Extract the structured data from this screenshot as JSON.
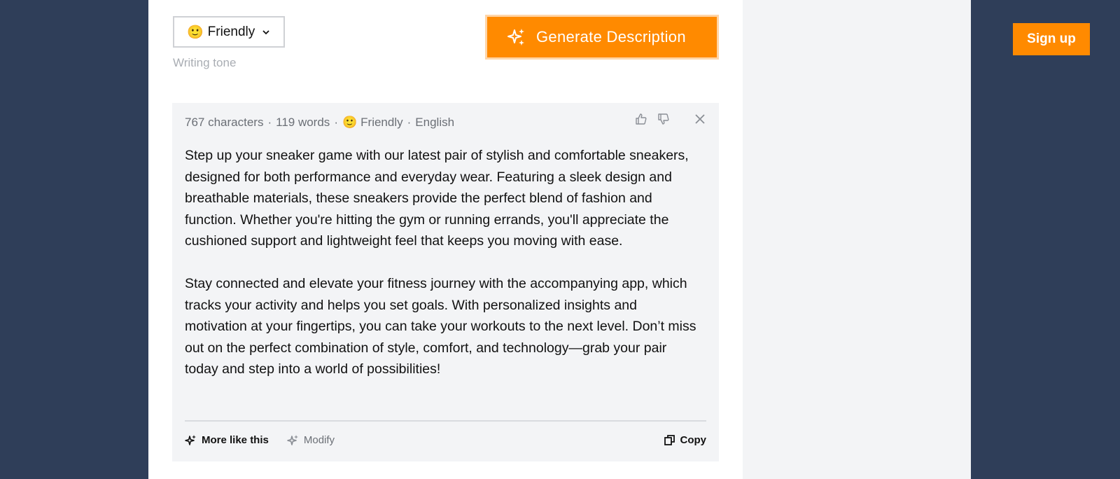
{
  "tone": {
    "emoji": "🙂",
    "selected": "Friendly",
    "label": "Writing tone"
  },
  "generate_button": {
    "label": "Generate Description",
    "icon": "sparkles-icon"
  },
  "signup_button": {
    "label": "Sign up"
  },
  "result": {
    "meta": {
      "characters": "767 characters",
      "words": "119 words",
      "tone_emoji": "🙂",
      "tone": "Friendly",
      "language": "English",
      "separator": "·"
    },
    "paragraphs": [
      "Step up your sneaker game with our latest pair of stylish and comfortable sneakers, designed for both performance and everyday wear. Featuring a sleek design and breathable materials, these sneakers provide the perfect blend of fashion and function. Whether you're hitting the gym or running errands, you'll appreciate the cushioned support and lightweight feel that keeps you moving with ease.",
      "Stay connected and elevate your fitness journey with the accompanying app, which tracks your activity and helps you set goals. With personalized insights and motivation at your fingertips, you can take your workouts to the next level. Don’t miss out on the perfect combination of style, comfort, and technology—grab your pair today and step into a world of possibilities!"
    ],
    "actions": {
      "more_like_this": "More like this",
      "modify": "Modify",
      "copy": "Copy"
    }
  },
  "colors": {
    "accent": "#ff8a00",
    "page_bg": "#2f3e59",
    "card_bg": "#f3f4f6"
  }
}
